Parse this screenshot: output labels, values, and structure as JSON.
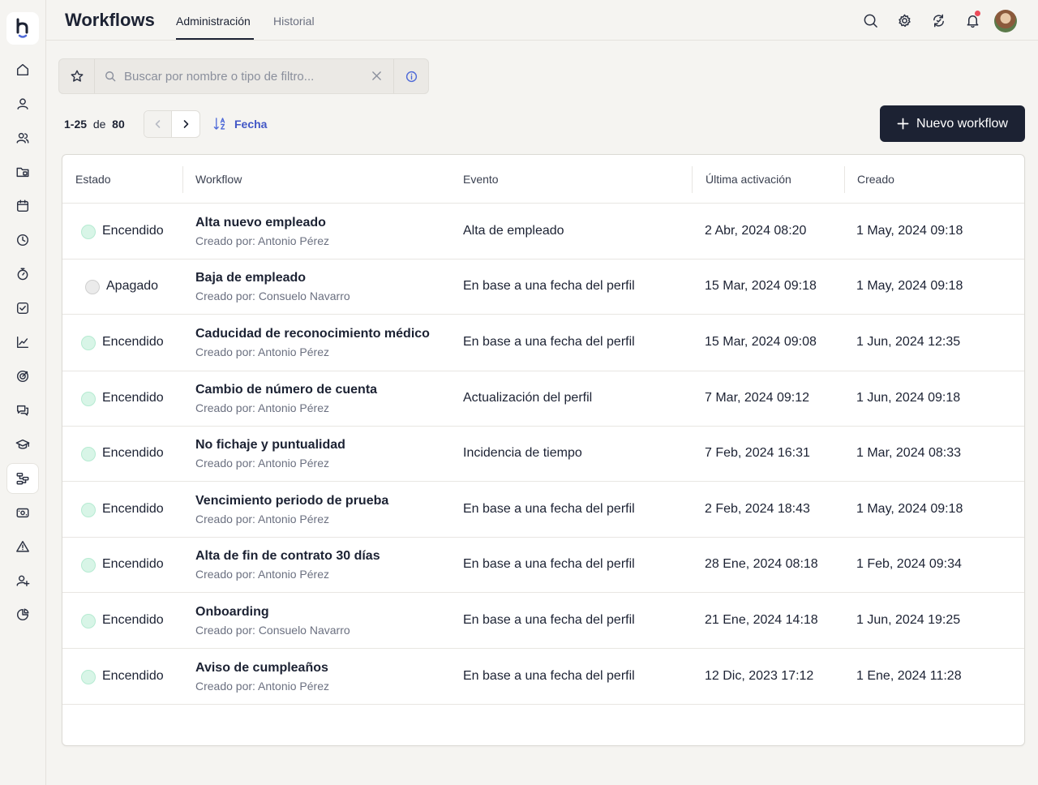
{
  "app": {
    "title": "Workflows"
  },
  "tabs": [
    {
      "label": "Administración",
      "active": true
    },
    {
      "label": "Historial",
      "active": false
    }
  ],
  "sidebar": {
    "items": [
      {
        "icon": "home-icon"
      },
      {
        "icon": "user-icon"
      },
      {
        "icon": "users-icon"
      },
      {
        "icon": "folder-icon"
      },
      {
        "icon": "calendar-icon"
      },
      {
        "icon": "clock-icon"
      },
      {
        "icon": "timer-icon"
      },
      {
        "icon": "check-square-icon"
      },
      {
        "icon": "chart-line-icon"
      },
      {
        "icon": "target-icon"
      },
      {
        "icon": "chat-icon"
      },
      {
        "icon": "graduation-cap-icon"
      },
      {
        "icon": "workflow-icon",
        "active": true
      },
      {
        "icon": "payment-icon"
      },
      {
        "icon": "warning-icon"
      },
      {
        "icon": "user-add-icon"
      },
      {
        "icon": "pie-chart-icon"
      }
    ]
  },
  "header_icons": [
    "search-icon",
    "gear-icon",
    "refresh-icon",
    "bell-icon",
    "avatar"
  ],
  "search": {
    "placeholder": "Buscar por nombre o tipo de filtro...",
    "value": ""
  },
  "pagination": {
    "range": "1-25",
    "of_label": "de",
    "total": "80"
  },
  "sort": {
    "label": "Fecha"
  },
  "new_button": {
    "label": "Nuevo workflow"
  },
  "table": {
    "columns": [
      "Estado",
      "Workflow",
      "Evento",
      "Última activación",
      "Creado"
    ],
    "rows": [
      {
        "status": "Encendido",
        "on": true,
        "name": "Alta nuevo empleado",
        "creator": "Creado por: Antonio Pérez",
        "event": "Alta de empleado",
        "last": "2 Abr, 2024 08:20",
        "created": "1 May, 2024 09:18"
      },
      {
        "status": "Apagado",
        "on": false,
        "name": "Baja de empleado",
        "creator": "Creado por: Consuelo Navarro",
        "event": "En base a una fecha del perfil",
        "last": "15 Mar, 2024  09:18",
        "created": "1 May, 2024 09:18"
      },
      {
        "status": "Encendido",
        "on": true,
        "name": "Caducidad de reconocimiento médico",
        "creator": "Creado por: Antonio Pérez",
        "event": "En base a una fecha del perfil",
        "last": "15 Mar, 2024 09:08",
        "created": "1 Jun, 2024 12:35"
      },
      {
        "status": "Encendido",
        "on": true,
        "name": "Cambio de número de cuenta",
        "creator": "Creado por: Antonio Pérez",
        "event": "Actualización del perfil",
        "last": "7 Mar, 2024 09:12",
        "created": "1 Jun, 2024 09:18"
      },
      {
        "status": "Encendido",
        "on": true,
        "name": "No fichaje y puntualidad",
        "creator": "Creado por: Antonio Pérez",
        "event": "Incidencia de tiempo",
        "last": "7 Feb, 2024 16:31",
        "created": "1 Mar, 2024 08:33"
      },
      {
        "status": "Encendido",
        "on": true,
        "name": "Vencimiento periodo de prueba",
        "creator": "Creado por: Antonio Pérez",
        "event": "En base a una fecha del perfil",
        "last": "2 Feb, 2024 18:43",
        "created": "1 May, 2024 09:18"
      },
      {
        "status": "Encendido",
        "on": true,
        "name": "Alta de fin de contrato 30 días",
        "creator": "Creado por: Antonio Pérez",
        "event": "En base a una fecha del perfil",
        "last": "28 Ene, 2024 08:18",
        "created": "1 Feb, 2024 09:34"
      },
      {
        "status": "Encendido",
        "on": true,
        "name": "Onboarding",
        "creator": "Creado por: Consuelo Navarro",
        "event": "En base a una fecha del perfil",
        "last": "21 Ene, 2024 14:18",
        "created": "1 Jun, 2024 19:25"
      },
      {
        "status": "Encendido",
        "on": true,
        "name": "Aviso de cumpleaños",
        "creator": "Creado por: Antonio Pérez",
        "event": "En base a una fecha del perfil",
        "last": "12 Dic, 2023 17:12",
        "created": "1 Ene, 2024 11:28"
      }
    ]
  },
  "colors": {
    "primary": "#1c2233",
    "accent": "#4257c6",
    "status_on": "#d8f5e7",
    "status_off": "#ebebeb",
    "notification": "#ec4b5a"
  }
}
